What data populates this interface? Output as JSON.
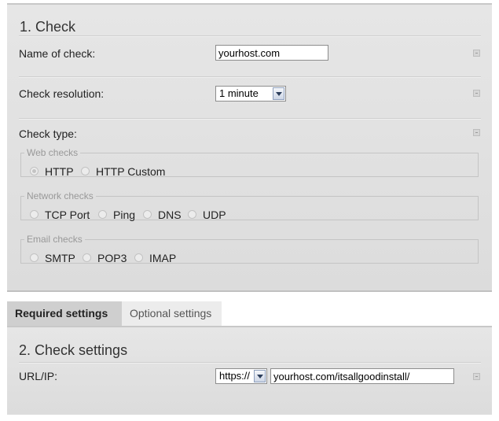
{
  "section1": {
    "title": "1. Check",
    "name_label": "Name of check:",
    "name_value": "yourhost.com",
    "resolution_label": "Check resolution:",
    "resolution_value": "1 minute",
    "type_label": "Check type:",
    "groups": [
      {
        "legend": "Web checks",
        "options": [
          "HTTP",
          "HTTP Custom"
        ]
      },
      {
        "legend": "Network checks",
        "options": [
          "TCP Port",
          "Ping",
          "DNS",
          "UDP"
        ]
      },
      {
        "legend": "Email checks",
        "options": [
          "SMTP",
          "POP3",
          "IMAP"
        ]
      }
    ],
    "selected_type": "HTTP"
  },
  "tabs": {
    "required": "Required settings",
    "optional": "Optional settings",
    "active": "Required settings"
  },
  "section2": {
    "title": "2. Check settings",
    "url_label": "URL/IP:",
    "protocol_value": "https://",
    "url_value": "yourhost.com/itsallgoodinstall/"
  }
}
